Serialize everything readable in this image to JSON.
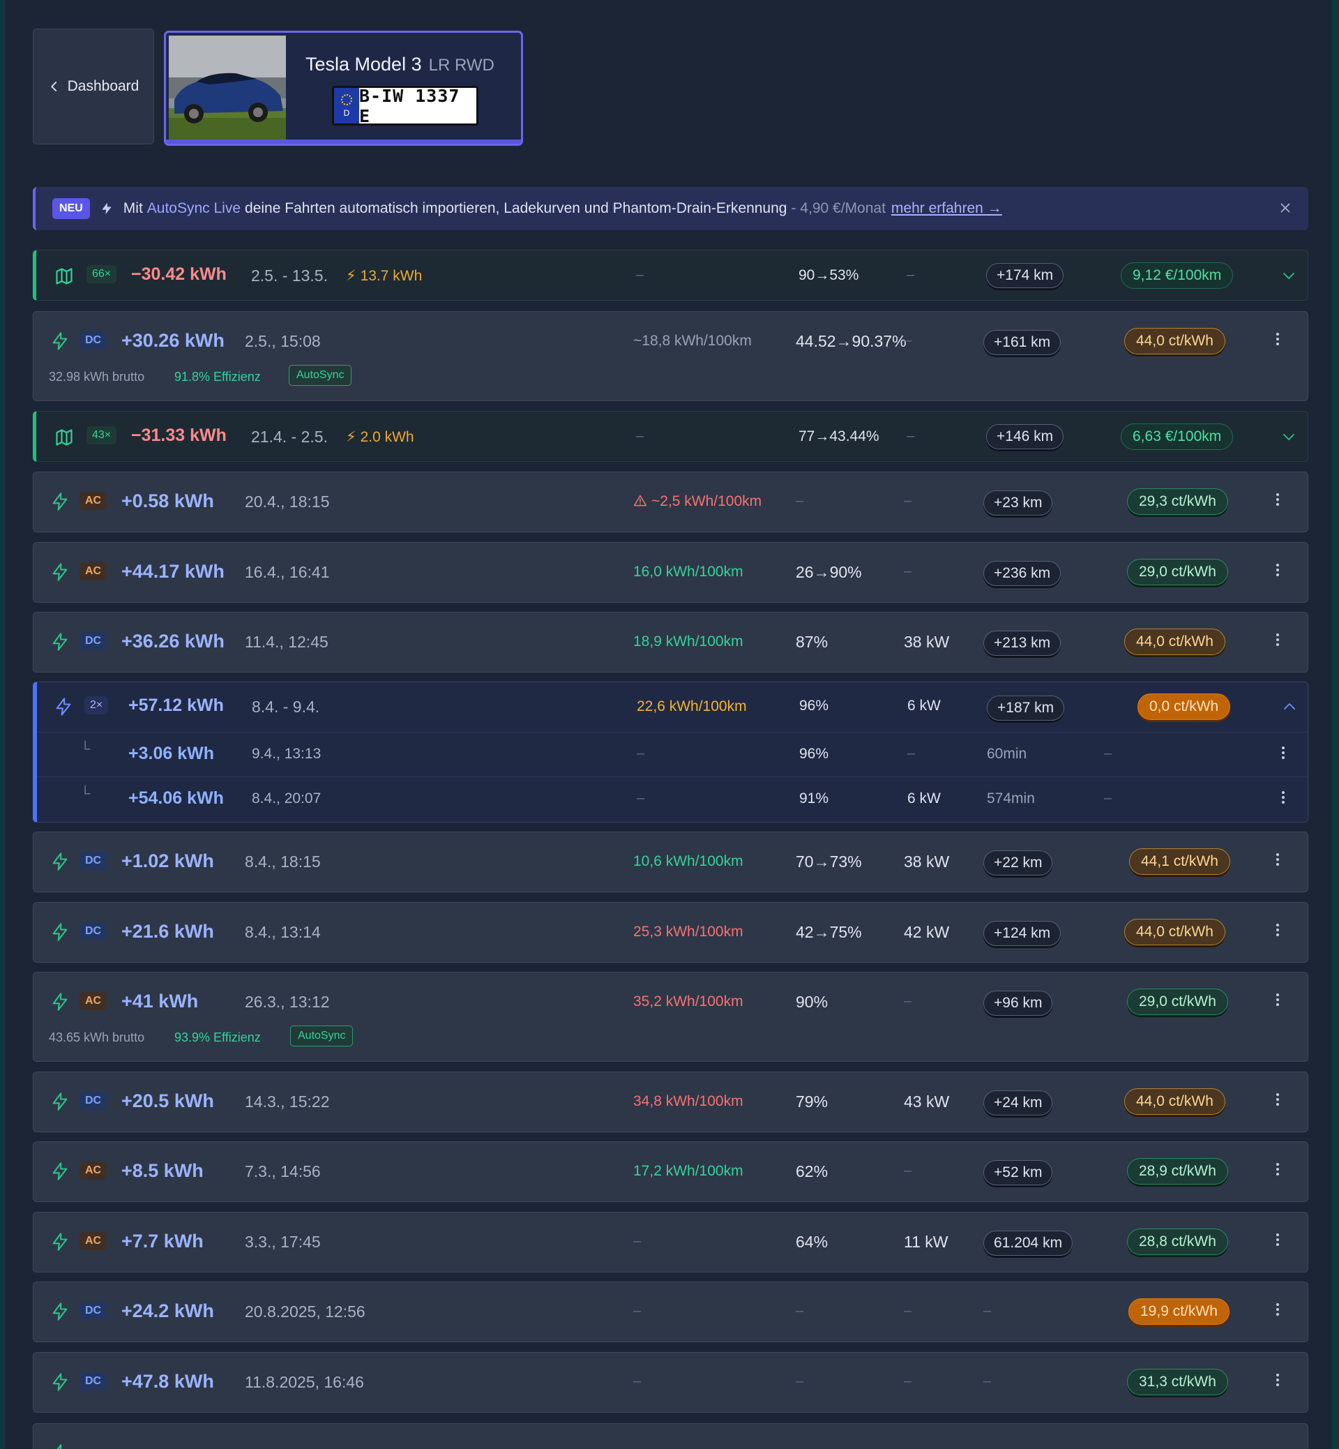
{
  "header": {
    "back_label": "Dashboard",
    "car_name": "Tesla Model 3",
    "car_variant": "LR RWD",
    "plate_country": "D",
    "plate_text": "B-IW 1337 E"
  },
  "banner": {
    "badge": "NEU",
    "prefix": "Mit",
    "highlight": "AutoSync Live",
    "text": "deine Fahrten automatisch importieren, Ladekurven und Phantom-Drain-Erkennung",
    "price": "- 4,90 €/Monat",
    "link": "mehr erfahren →"
  },
  "dash": "–",
  "rows": [
    {
      "type": "trip",
      "count": "66×",
      "energy": "−30.42 kWh",
      "date": "2.5. - 13.5.",
      "charged": "13.7 kWh",
      "soc": "90→53%",
      "km": "+174 km",
      "cost": "9,12 €/100km"
    },
    {
      "type": "charge",
      "tag": "DC",
      "energy": "+30.26 kWh",
      "date": "2.5., 15:08",
      "cons": "~18,8 kWh/100km",
      "soc": "44.52→90.37%",
      "km": "+161 km",
      "price": "44,0 ct/kWh",
      "brutto": "32.98 kWh brutto",
      "eff": "91.8% Effizienz",
      "autosync": "AutoSync"
    },
    {
      "type": "trip",
      "count": "43×",
      "energy": "−31.33 kWh",
      "date": "21.4. - 2.5.",
      "charged": "2.0 kWh",
      "soc": "77→43.44%",
      "km": "+146 km",
      "cost": "6,63 €/100km"
    },
    {
      "type": "charge",
      "tag": "AC",
      "energy": "+0.58 kWh",
      "date": "20.4., 18:15",
      "cons": "~2,5 kWh/100km",
      "km": "+23 km",
      "price": "29,3 ct/kWh"
    },
    {
      "type": "charge",
      "tag": "AC",
      "energy": "+44.17 kWh",
      "date": "16.4., 16:41",
      "cons": "16,0 kWh/100km",
      "soc": "26→90%",
      "km": "+236 km",
      "price": "29,0 ct/kWh"
    },
    {
      "type": "charge",
      "tag": "DC",
      "energy": "+36.26 kWh",
      "date": "11.4., 12:45",
      "cons": "18,9 kWh/100km",
      "soc": "87%",
      "kw": "38 kW",
      "km": "+213 km",
      "price": "44,0 ct/kWh"
    },
    {
      "type": "group",
      "count": "2×",
      "energy": "+57.12 kWh",
      "date": "8.4. - 9.4.",
      "cons": "22,6 kWh/100km",
      "soc": "96%",
      "kw": "6 kW",
      "km": "+187 km",
      "price": "0,0 ct/kWh",
      "sub": [
        {
          "energy": "+3.06 kWh",
          "date": "9.4., 13:13",
          "soc": "96%",
          "dur": "60min"
        },
        {
          "energy": "+54.06 kWh",
          "date": "8.4., 20:07",
          "soc": "91%",
          "kw": "6 kW",
          "dur": "574min"
        }
      ]
    },
    {
      "type": "charge",
      "tag": "DC",
      "energy": "+1.02 kWh",
      "date": "8.4., 18:15",
      "cons": "10,6 kWh/100km",
      "soc": "70→73%",
      "kw": "38 kW",
      "km": "+22 km",
      "price": "44,1 ct/kWh"
    },
    {
      "type": "charge",
      "tag": "DC",
      "energy": "+21.6 kWh",
      "date": "8.4., 13:14",
      "cons": "25,3 kWh/100km",
      "soc": "42→75%",
      "kw": "42 kW",
      "km": "+124 km",
      "price": "44,0 ct/kWh"
    },
    {
      "type": "charge",
      "tag": "AC",
      "energy": "+41 kWh",
      "date": "26.3., 13:12",
      "cons": "35,2 kWh/100km",
      "soc": "90%",
      "km": "+96 km",
      "price": "29,0 ct/kWh",
      "brutto": "43.65 kWh brutto",
      "eff": "93.9% Effizienz",
      "autosync": "AutoSync"
    },
    {
      "type": "charge",
      "tag": "DC",
      "energy": "+20.5 kWh",
      "date": "14.3., 15:22",
      "cons": "34,8 kWh/100km",
      "soc": "79%",
      "kw": "43 kW",
      "km": "+24 km",
      "price": "44,0 ct/kWh"
    },
    {
      "type": "charge",
      "tag": "AC",
      "energy": "+8.5 kWh",
      "date": "7.3., 14:56",
      "cons": "17,2 kWh/100km",
      "soc": "62%",
      "km": "+52 km",
      "price": "28,9 ct/kWh"
    },
    {
      "type": "charge",
      "tag": "AC",
      "energy": "+7.7 kWh",
      "date": "3.3., 17:45",
      "soc": "64%",
      "kw": "11 kW",
      "km": "61.204 km",
      "price": "28,8 ct/kWh"
    },
    {
      "type": "charge",
      "tag": "DC",
      "energy": "+24.2 kWh",
      "date": "20.8.2025, 12:56",
      "price": "19,9 ct/kWh"
    },
    {
      "type": "charge",
      "tag": "DC",
      "energy": "+47.8 kWh",
      "date": "11.8.2025, 16:46",
      "price": "31,3 ct/kWh"
    }
  ],
  "colors": {
    "accent": "#6a66f0",
    "positive": "#34d399",
    "negative": "#f87171",
    "warning": "#f5b431",
    "dc": "#7ea2ff",
    "ac": "#f0a460"
  }
}
